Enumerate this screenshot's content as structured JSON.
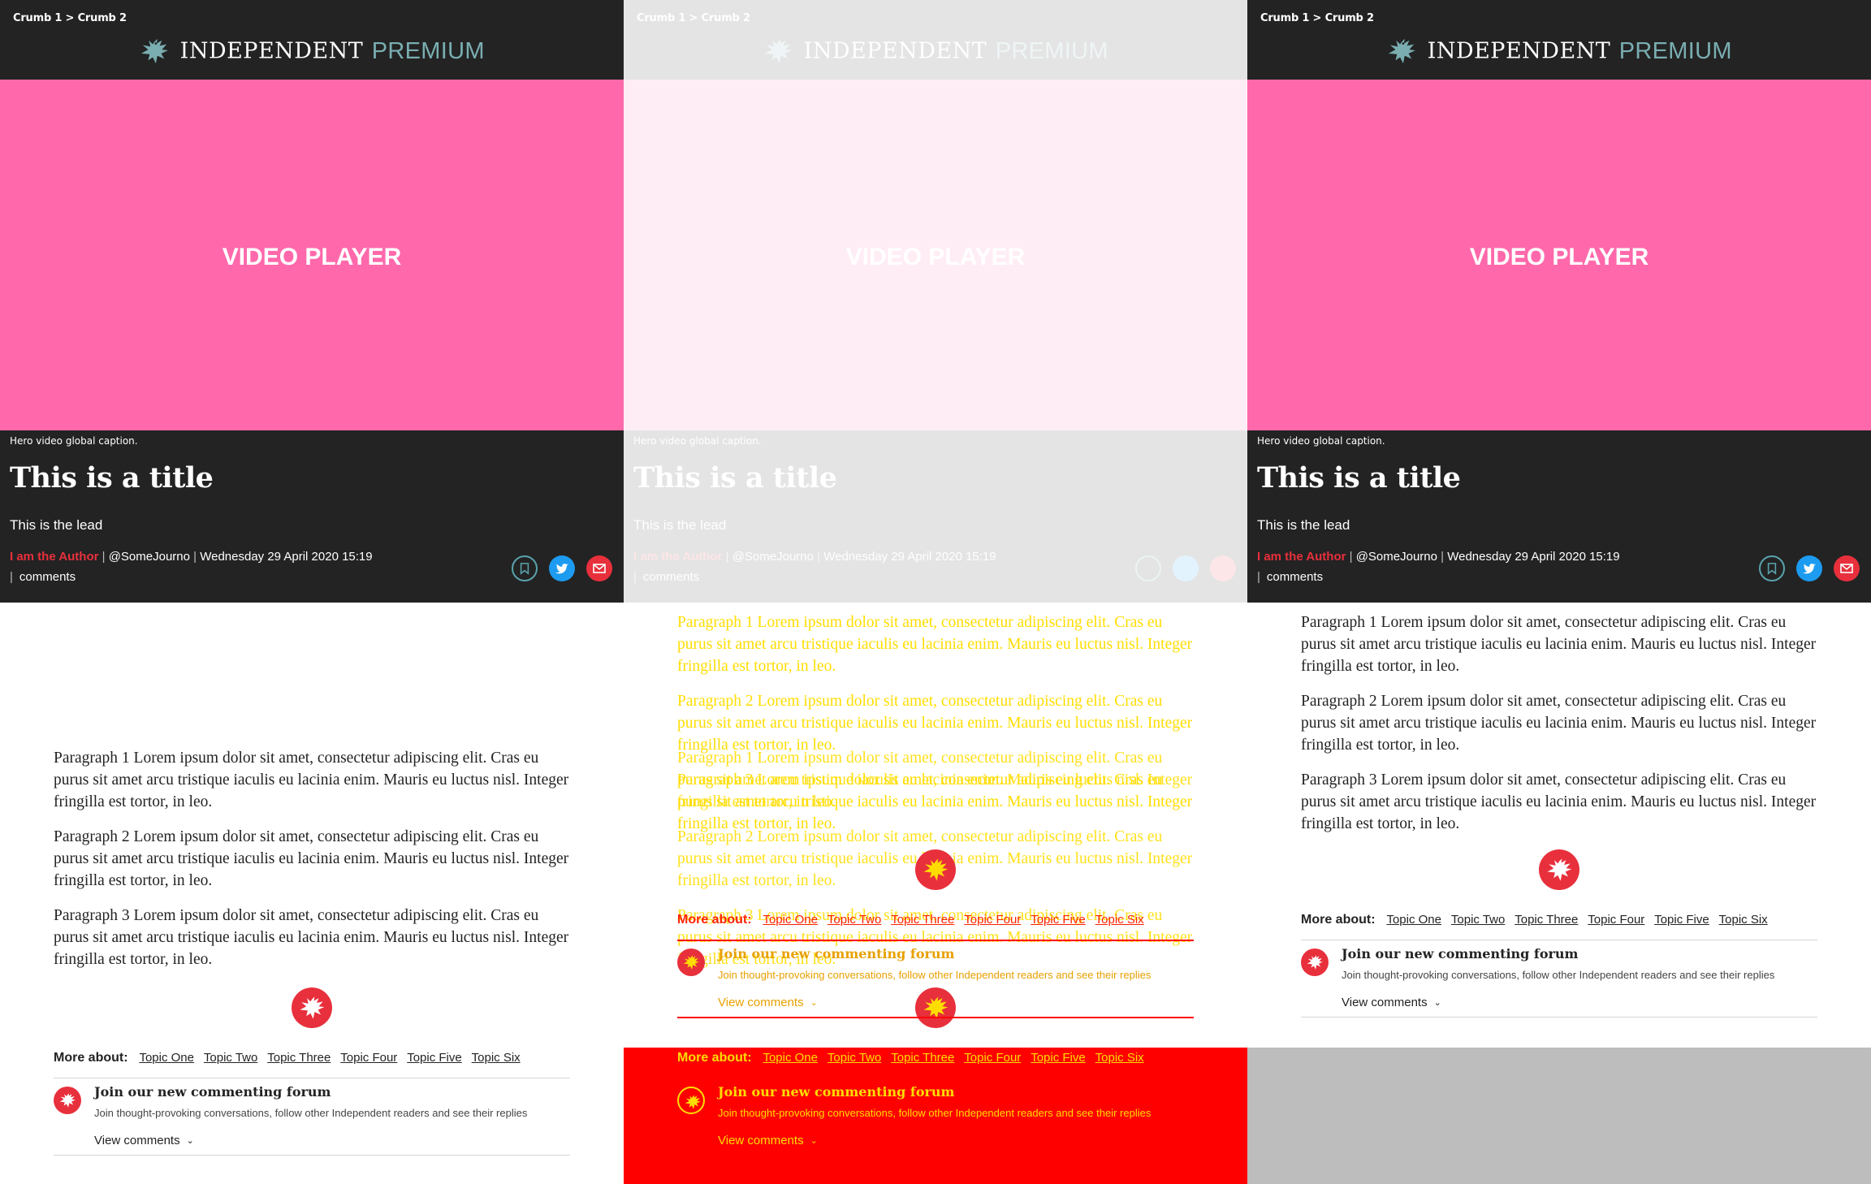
{
  "panels": [
    {
      "id": "expected",
      "crumbs": [
        "Crumb 1",
        "Crumb 2"
      ],
      "brand": "INDEPENDENT",
      "premium": "PREMIUM",
      "video_label": "VIDEO PLAYER",
      "caption": "Hero video global caption.",
      "title": "This is a title",
      "lead": "This is the lead",
      "author": "I am the Author",
      "handle": "@SomeJourno",
      "date": "Wednesday 29 April 2020 15:19",
      "comments_label": "comments",
      "paragraphs": [
        "Paragraph 1 Lorem ipsum dolor sit amet, consectetur adipiscing elit. Cras eu purus sit amet arcu tristique iaculis eu lacinia enim. Mauris eu luctus nisl. Integer fringilla est tortor, in leo.",
        "Paragraph 2 Lorem ipsum dolor sit amet, consectetur adipiscing elit. Cras eu purus sit amet arcu tristique iaculis eu lacinia enim. Mauris eu luctus nisl. Integer fringilla est tortor, in leo.",
        "Paragraph 3 Lorem ipsum dolor sit amet, consectetur adipiscing elit. Cras eu purus sit amet arcu tristique iaculis eu lacinia enim. Mauris eu luctus nisl. Integer fringilla est tortor, in leo."
      ],
      "more_about": "More about:",
      "topics": [
        "Topic One",
        "Topic Two",
        "Topic Three",
        "Topic Four",
        "Topic Five",
        "Topic Six"
      ],
      "forum_title": "Join our new commenting forum",
      "forum_desc": "Join thought-provoking conversations, follow other Independent readers and see their replies",
      "view_comments": "View comments"
    }
  ],
  "colors": {
    "header_bg": "#232323",
    "video_bg": "#ff69ab",
    "accent_red": "#e8303c",
    "premium_teal": "#7aaeb1",
    "diff_red": "#ff0000",
    "diff_yellow": "#ffdd00",
    "diff_gray": "#bdbdbd"
  },
  "icons": [
    "eagle-logo-icon",
    "bookmark-icon",
    "twitter-icon",
    "mail-icon",
    "chevron-down-icon"
  ]
}
